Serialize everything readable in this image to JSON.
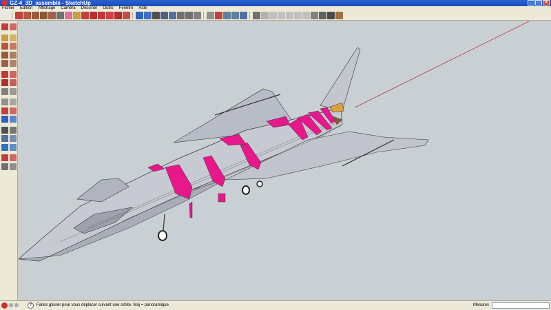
{
  "window": {
    "title": "GZ-4_3D_assemblé - SketchUp"
  },
  "menu": [
    "Fichier",
    "Edition",
    "Affichage",
    "Caméra",
    "Dessiner",
    "Outils",
    "Fenêtre",
    "Aide"
  ],
  "toolbar_icons": [
    {
      "name": "select-arrow-icon",
      "color": "#e8e8e8"
    },
    {
      "name": "pencil-icon",
      "color": "#c0403a"
    },
    {
      "name": "rectangle-icon",
      "color": "#b4563c"
    },
    {
      "name": "circle-icon",
      "color": "#9a5a3a"
    },
    {
      "name": "arc-icon",
      "color": "#8a5a3a"
    },
    {
      "name": "polygon-icon",
      "color": "#a06048"
    },
    {
      "name": "freehand-icon",
      "color": "#707070"
    },
    {
      "name": "eraser-icon",
      "color": "#e070a0"
    },
    {
      "name": "paint-bucket-icon",
      "color": "#c8a040"
    },
    {
      "name": "push-pull-icon",
      "color": "#c04040"
    },
    {
      "name": "move-icon",
      "color": "#b83030"
    },
    {
      "name": "rotate-icon",
      "color": "#c03838"
    },
    {
      "name": "follow-me-icon",
      "color": "#d04040"
    },
    {
      "name": "scale-icon",
      "color": "#b03030"
    },
    {
      "name": "offset-icon",
      "color": "#c84848"
    },
    {
      "name": "orbit-icon",
      "color": "#3060c0"
    },
    {
      "name": "pan-icon",
      "color": "#4070c0"
    },
    {
      "name": "zoom-icon",
      "color": "#505050"
    },
    {
      "name": "zoom-window-icon",
      "color": "#506080"
    },
    {
      "name": "zoom-extents-icon",
      "color": "#5070a0"
    },
    {
      "name": "previous-view-icon",
      "color": "#707070"
    },
    {
      "name": "next-view-icon",
      "color": "#707070"
    },
    {
      "name": "tape-measure-icon",
      "color": "#808080"
    },
    {
      "name": "protractor-icon",
      "color": "#909090"
    },
    {
      "name": "axes-icon",
      "color": "#c04040"
    },
    {
      "name": "dimension-icon",
      "color": "#6080a0"
    },
    {
      "name": "text-icon",
      "color": "#6080a0"
    },
    {
      "name": "3d-text-icon",
      "color": "#5070a0"
    },
    {
      "name": "section-plane-icon",
      "color": "#707070"
    },
    {
      "name": "iso-view-icon",
      "color": "#b0b0b0"
    },
    {
      "name": "top-view-icon",
      "color": "#c0c0c0"
    },
    {
      "name": "front-view-icon",
      "color": "#c0c0c0"
    },
    {
      "name": "right-view-icon",
      "color": "#c0c0c0"
    },
    {
      "name": "back-view-icon",
      "color": "#c0c0c0"
    },
    {
      "name": "left-view-icon",
      "color": "#c0c0c0"
    },
    {
      "name": "xray-icon",
      "color": "#808080"
    },
    {
      "name": "wireframe-icon",
      "color": "#606060"
    },
    {
      "name": "shaded-icon",
      "color": "#4a4a4a"
    },
    {
      "name": "textured-icon",
      "color": "#a07040"
    }
  ],
  "sidebar_icons": [
    [
      "select-icon",
      "component-icon"
    ],
    [
      "paint-icon",
      "eraser-icon"
    ],
    [
      "rectangle-icon",
      "line-icon"
    ],
    [
      "circle-icon",
      "arc-icon"
    ],
    [
      "polygon-icon",
      "freehand-icon"
    ],
    [
      "move-icon",
      "push-pull-icon"
    ],
    [
      "rotate-icon",
      "follow-me-icon"
    ],
    [
      "scale-icon",
      "offset-icon"
    ],
    [
      "tape-icon",
      "dimension-icon"
    ],
    [
      "protractor-icon",
      "text-icon"
    ],
    [
      "axes-icon",
      "3d-text-icon"
    ],
    [
      "orbit-icon",
      "pan-icon"
    ],
    [
      "zoom-icon",
      "zoom-window-icon"
    ],
    [
      "previous-icon",
      "zoom-extents-icon"
    ],
    [
      "position-camera-icon",
      "walk-icon"
    ],
    [
      "look-around-icon",
      "section-icon"
    ]
  ],
  "status": {
    "hint": "Faites glisser pour vous déplacer suivant une orbite. Maj = panoramique",
    "help": "?",
    "measures_label": "Mesures",
    "measures_value": ""
  },
  "colors": {
    "viewport_bg": "#c8d0d4",
    "hull": "#c7cad3",
    "hull_dark": "#a9adb8",
    "frames": "#e8188c",
    "red_axis": "#c03030"
  }
}
